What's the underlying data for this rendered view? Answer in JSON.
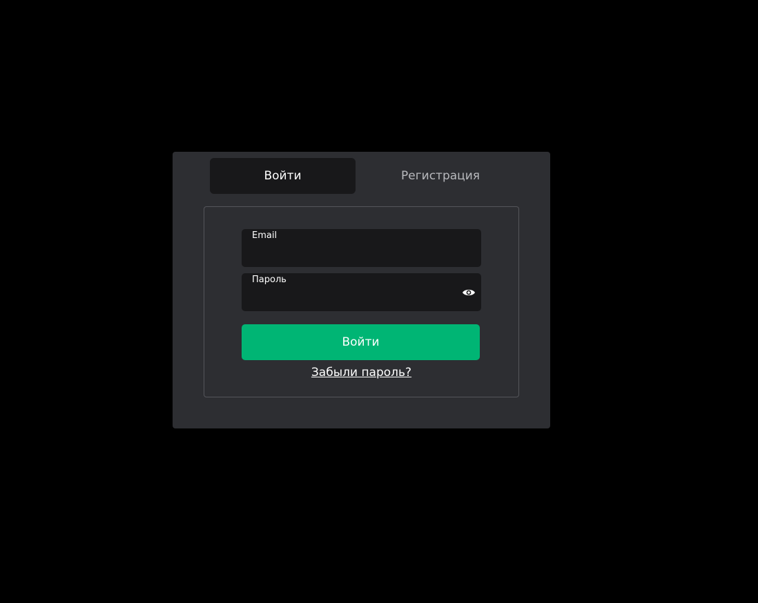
{
  "tabs": {
    "login_label": "Войти",
    "register_label": "Регистрация"
  },
  "form": {
    "email_label": "Email",
    "email_value": "",
    "password_label": "Пароль",
    "password_value": "",
    "password_toggle_icon": "eye-icon",
    "submit_label": "Войти",
    "forgot_label": "Забыли пароль?"
  },
  "colors": {
    "background": "#000000",
    "panel": "#2d2e32",
    "input": "#18181a",
    "accent": "#00b574"
  }
}
